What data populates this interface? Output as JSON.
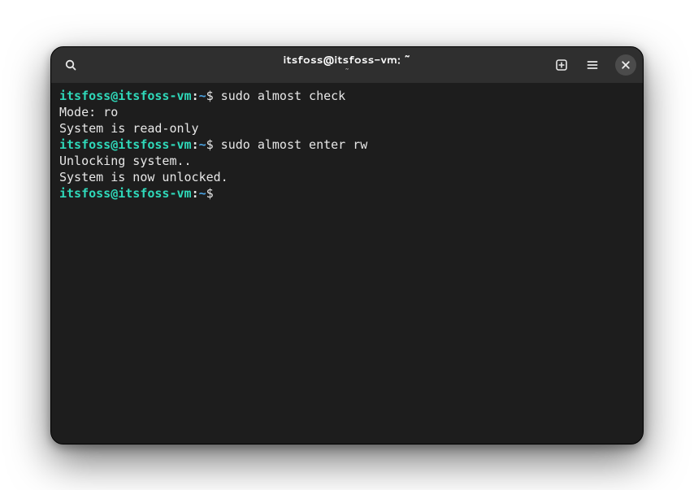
{
  "header": {
    "title": "itsfoss@itsfoss-vm: ~",
    "subtitle": "~"
  },
  "icons": {
    "search": "search-icon",
    "new_tab": "new-tab-icon",
    "menu": "hamburger-menu-icon",
    "close": "close-icon"
  },
  "terminal": {
    "prompt_user_host": "itsfoss@itsfoss-vm",
    "prompt_colon": ":",
    "prompt_path": "~",
    "prompt_dollar": "$",
    "lines": [
      {
        "type": "prompt",
        "command": "sudo almost check"
      },
      {
        "type": "output",
        "text": "Mode: ro"
      },
      {
        "type": "output",
        "text": "System is read-only"
      },
      {
        "type": "prompt",
        "command": "sudo almost enter rw"
      },
      {
        "type": "output",
        "text": "Unlocking system.."
      },
      {
        "type": "output",
        "text": "System is now unlocked."
      },
      {
        "type": "prompt",
        "command": ""
      }
    ]
  },
  "colors": {
    "window_bg": "#1d1d1d",
    "titlebar_bg": "#2f2f2f",
    "prompt_user": "#2fd8b9",
    "prompt_path": "#4ba3e2",
    "text": "#e7e7e7"
  }
}
